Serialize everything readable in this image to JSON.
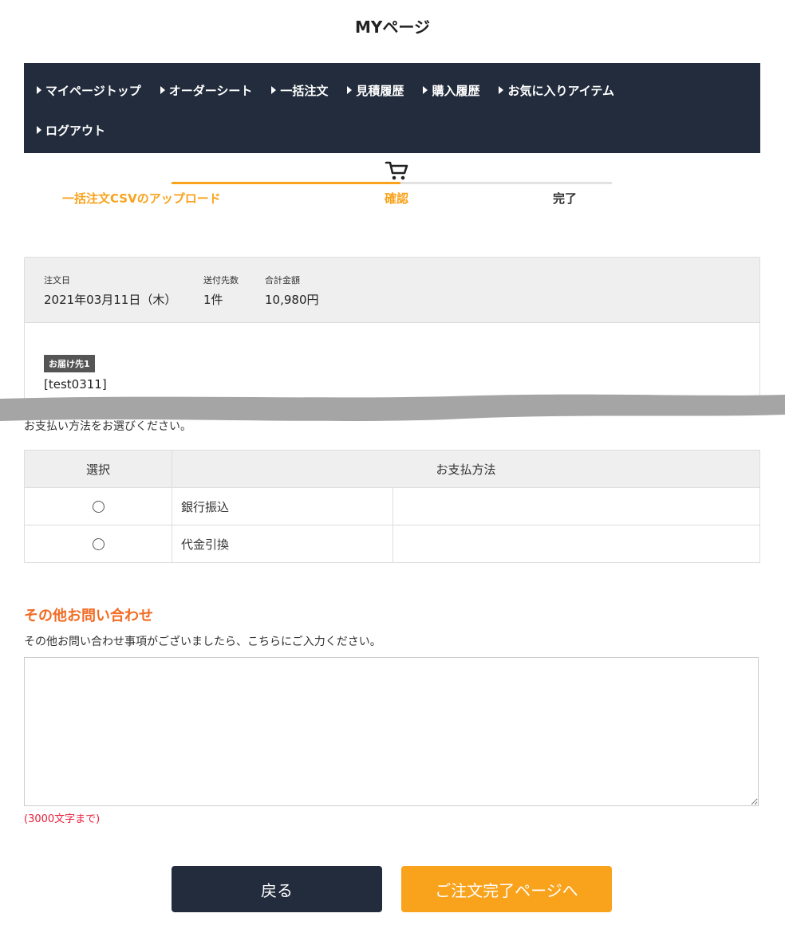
{
  "page": {
    "title": "MYページ"
  },
  "nav": {
    "row1": [
      {
        "label": "マイページトップ"
      },
      {
        "label": "オーダーシート"
      },
      {
        "label": "一括注文"
      },
      {
        "label": "見積履歴"
      },
      {
        "label": "購入履歴"
      },
      {
        "label": "お気に入りアイテム"
      }
    ],
    "row2": [
      {
        "label": "ログアウト"
      }
    ]
  },
  "steps": {
    "items": [
      {
        "label": "一括注文CSVのアップロード",
        "state": "done"
      },
      {
        "label": "確認",
        "state": "current"
      },
      {
        "label": "完了",
        "state": "pending"
      }
    ],
    "progress_fraction": 0.52,
    "current_icon": "cart-icon"
  },
  "summary": {
    "order_date_label": "注文日",
    "order_date": "2021年03月11日（木）",
    "dest_count_label": "送付先数",
    "dest_count": "1件",
    "total_label": "合計金額",
    "total": "10,980円"
  },
  "destination": {
    "badge": "お届け先1",
    "name": "[test0311]"
  },
  "payment": {
    "prompt": "お支払い方法をお選びください。",
    "col_select": "選択",
    "col_method": "お支払方法",
    "methods": [
      {
        "name": "銀行振込"
      },
      {
        "name": "代金引換"
      }
    ]
  },
  "other": {
    "title": "その他お問い合わせ",
    "description": "その他お問い合わせ事項がございましたら、こちらにご入力ください。",
    "value": "",
    "limit_note": "(3000文字まで)"
  },
  "buttons": {
    "back": "戻る",
    "next": "ご注文完了ページへ"
  },
  "colors": {
    "nav_bg": "#222c3c",
    "accent_orange": "#f9a21b",
    "heading_orange": "#f26b22",
    "note_red": "#e8213a"
  }
}
